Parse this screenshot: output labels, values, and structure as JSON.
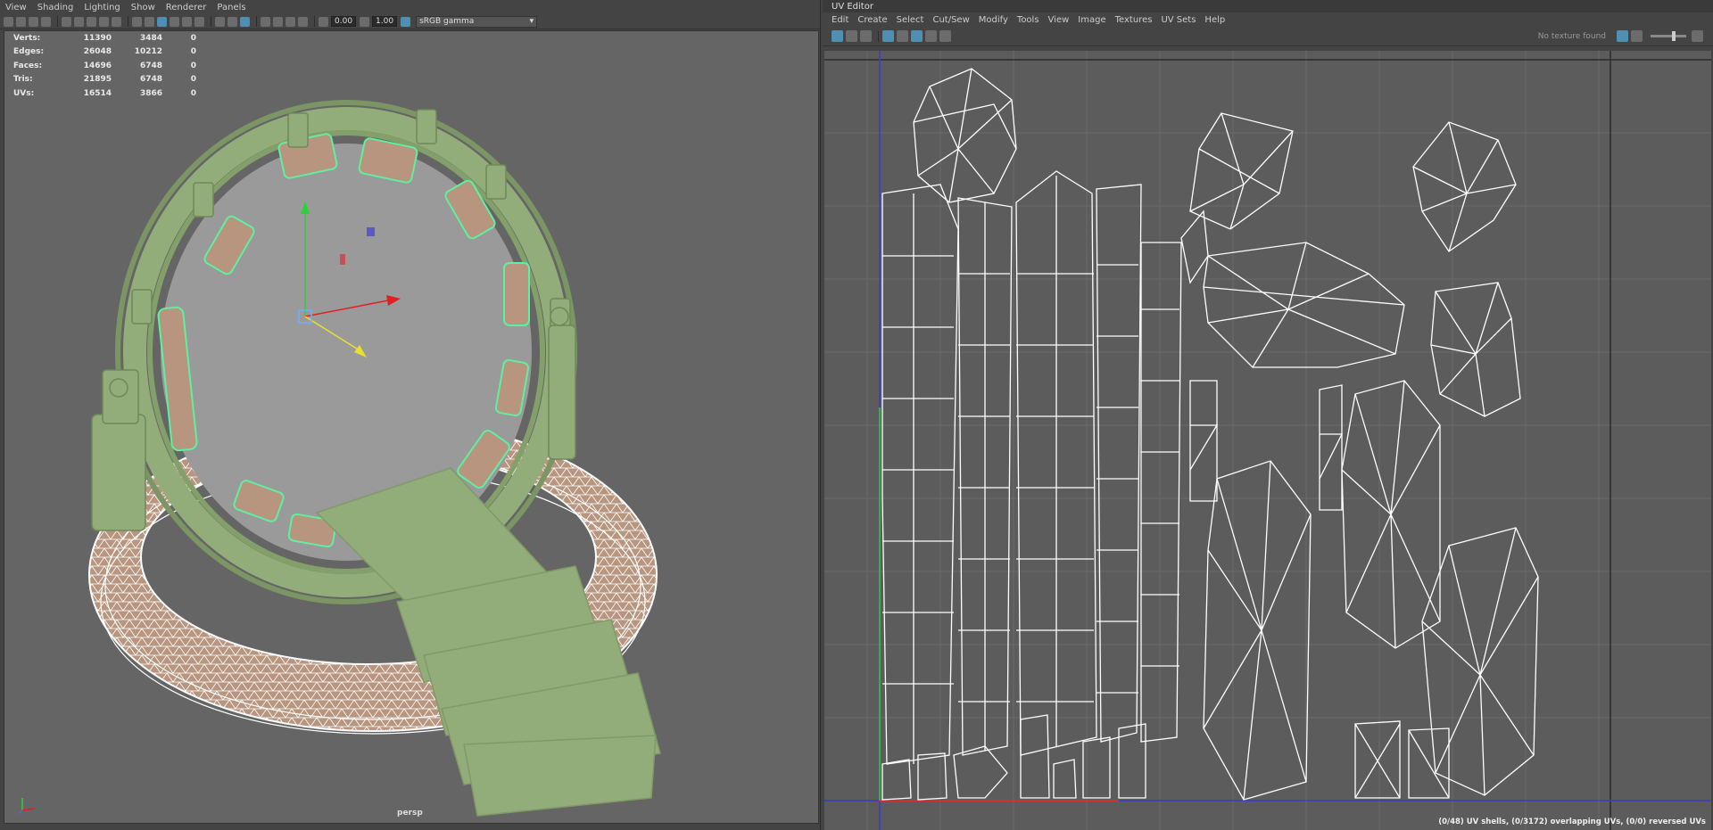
{
  "viewport_panel": {
    "menu": [
      "View",
      "Shading",
      "Lighting",
      "Show",
      "Renderer",
      "Panels"
    ],
    "toolbar": {
      "exposure_value": "0.00",
      "gamma_value": "1.00",
      "color_space": "sRGB gamma"
    },
    "hud": {
      "rows": [
        {
          "label": "Verts:",
          "a": "11390",
          "b": "3484",
          "c": "0"
        },
        {
          "label": "Edges:",
          "a": "26048",
          "b": "10212",
          "c": "0"
        },
        {
          "label": "Faces:",
          "a": "14696",
          "b": "6748",
          "c": "0"
        },
        {
          "label": "Tris:",
          "a": "21895",
          "b": "6748",
          "c": "0"
        },
        {
          "label": "UVs:",
          "a": "16514",
          "b": "3866",
          "c": "0"
        }
      ]
    },
    "camera_label": "persp",
    "colors": {
      "background": "#656565",
      "gate_mesh": "#93ad7a",
      "selection_wire": "#5ef0a0",
      "base_fill": "#b7957f",
      "wire": "#ffffff"
    }
  },
  "uv_editor": {
    "title": "UV Editor",
    "menu": [
      "Edit",
      "Create",
      "Select",
      "Cut/Sew",
      "Modify",
      "Tools",
      "View",
      "Image",
      "Textures",
      "UV Sets",
      "Help"
    ],
    "no_texture_label": "No texture found",
    "status": "(0/48) UV shells, (0/3172) overlapping UVs, (0/0) reversed UVs",
    "colors": {
      "background": "#5c5c5c",
      "grid": "#6a6a6a",
      "uv_wire": "#ffffff",
      "u_axis": "#d03030",
      "v_axis": "#3a3ad0"
    }
  }
}
